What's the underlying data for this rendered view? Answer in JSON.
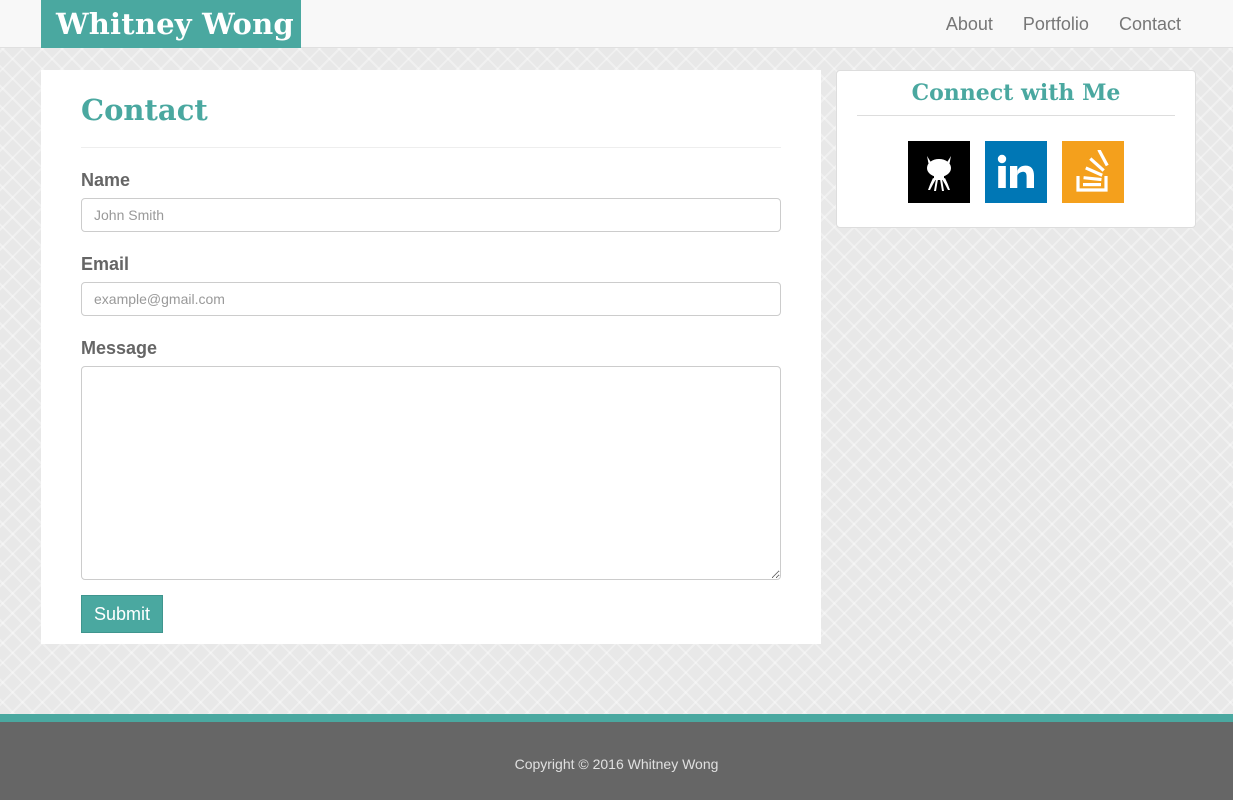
{
  "navbar": {
    "brand": "Whitney Wong",
    "links": [
      "About",
      "Portfolio",
      "Contact"
    ]
  },
  "contact": {
    "title": "Contact",
    "name": {
      "label": "Name",
      "placeholder": "John Smith",
      "value": ""
    },
    "email": {
      "label": "Email",
      "placeholder": "example@gmail.com",
      "value": ""
    },
    "message": {
      "label": "Message",
      "value": ""
    },
    "submit_label": "Submit"
  },
  "connect": {
    "title": "Connect with Me",
    "icons": [
      "github-icon",
      "linkedin-icon",
      "stackoverflow-icon"
    ]
  },
  "footer": {
    "copyright": "Copyright © 2016 Whitney Wong"
  },
  "colors": {
    "accent": "#4aa8a0",
    "footer_bg": "#666666",
    "github": "#000000",
    "linkedin": "#0077b5",
    "stackoverflow": "#f4a01c"
  }
}
